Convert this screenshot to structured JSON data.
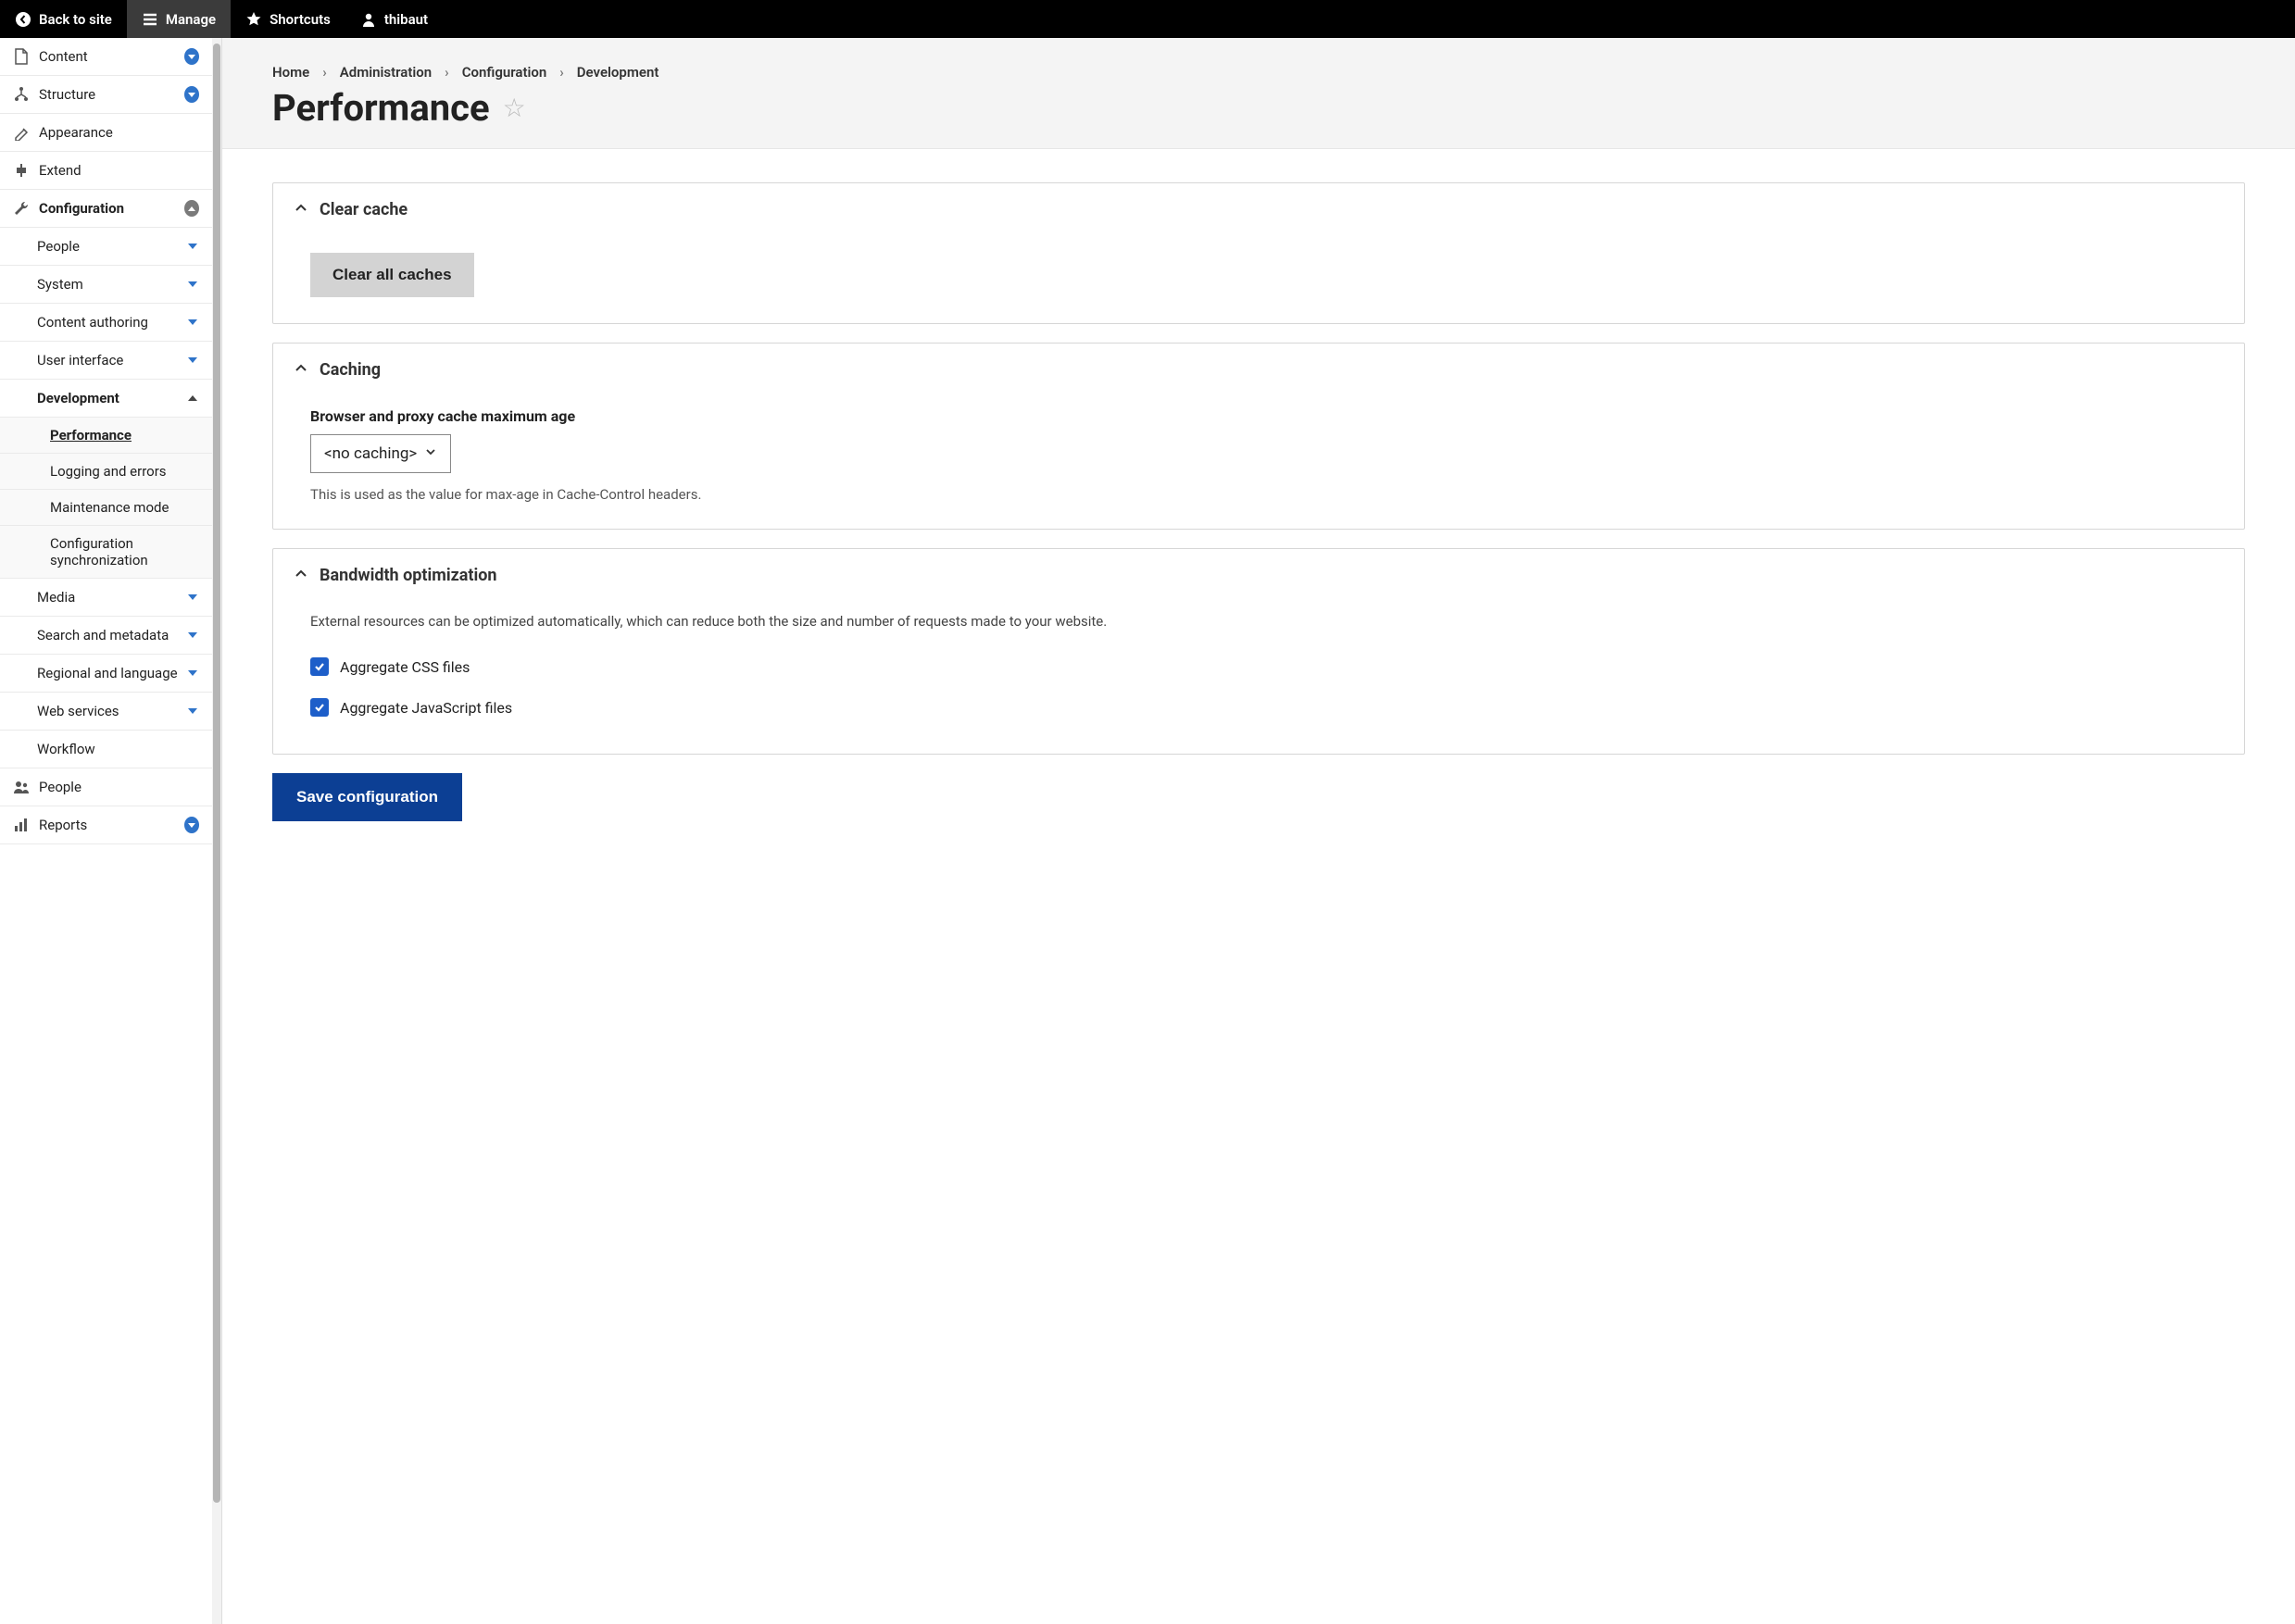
{
  "topbar": {
    "back_label": "Back to site",
    "manage_label": "Manage",
    "shortcuts_label": "Shortcuts",
    "user_label": "thibaut"
  },
  "sidebar": {
    "content_label": "Content",
    "structure_label": "Structure",
    "appearance_label": "Appearance",
    "extend_label": "Extend",
    "configuration_label": "Configuration",
    "config_children": {
      "people_label": "People",
      "system_label": "System",
      "content_authoring_label": "Content authoring",
      "user_interface_label": "User interface",
      "development_label": "Development",
      "dev_children": {
        "performance_label": "Performance",
        "logging_label": "Logging and errors",
        "maintenance_label": "Maintenance mode",
        "config_sync_label": "Configuration synchronization"
      },
      "media_label": "Media",
      "search_metadata_label": "Search and metadata",
      "regional_language_label": "Regional and language",
      "web_services_label": "Web services",
      "workflow_label": "Workflow"
    },
    "people_label": "People",
    "reports_label": "Reports"
  },
  "breadcrumb": {
    "home": "Home",
    "administration": "Administration",
    "configuration": "Configuration",
    "development": "Development"
  },
  "page_title": "Performance",
  "panels": {
    "clear_cache": {
      "title": "Clear cache",
      "button_label": "Clear all caches"
    },
    "caching": {
      "title": "Caching",
      "field_label": "Browser and proxy cache maximum age",
      "select_value": "<no caching>",
      "help_text": "This is used as the value for max-age in Cache-Control headers."
    },
    "bandwidth": {
      "title": "Bandwidth optimization",
      "desc": "External resources can be optimized automatically, which can reduce both the size and number of requests made to your website.",
      "css_label": "Aggregate CSS files",
      "js_label": "Aggregate JavaScript files"
    }
  },
  "save_button_label": "Save configuration"
}
